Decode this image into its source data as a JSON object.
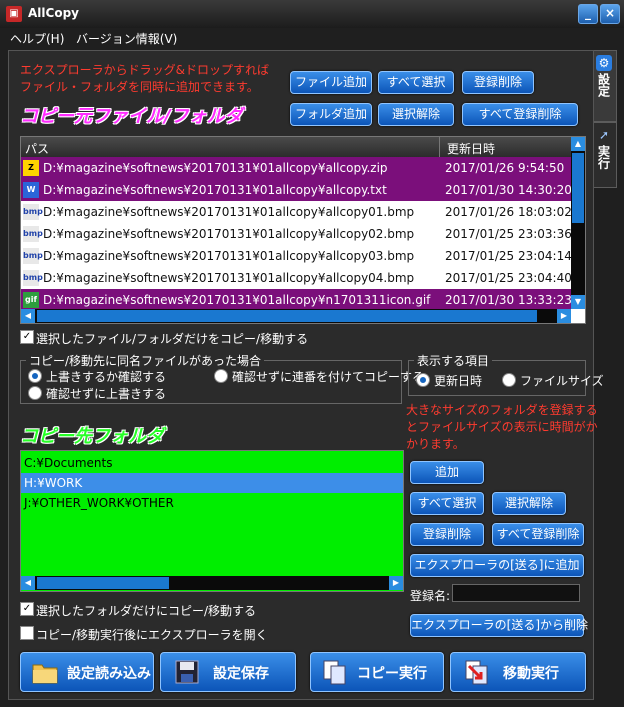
{
  "window": {
    "title": "AllCopy",
    "minimize": "_",
    "close": "×"
  },
  "menu": [
    "ヘルプ(H)",
    "バージョン情報(V)"
  ],
  "side_tabs": {
    "settings": "設定",
    "run": "実行"
  },
  "source": {
    "note_line1": "エクスプローラからドラッグ&ドロップすれば",
    "note_line2": "ファイル・フォルダを同時に追加できます。",
    "heading": "コピー元ファイル/フォルダ",
    "buttons": {
      "add_file": "ファイル追加",
      "select_all": "すべて選択",
      "remove": "登録削除",
      "add_folder": "フォルダ追加",
      "deselect": "選択解除",
      "remove_all": "すべて登録削除"
    },
    "columns": {
      "path": "パス",
      "modified": "更新日時"
    },
    "files": [
      {
        "path": "D:¥magazine¥softnews¥20170131¥01allcopy¥allcopy.zip",
        "date": "2017/01/26 9:54:50",
        "icon": "zip-icon",
        "selected": true
      },
      {
        "path": "D:¥magazine¥softnews¥20170131¥01allcopy¥allcopy.txt",
        "date": "2017/01/30 14:30:20",
        "icon": "txt-icon",
        "selected": true
      },
      {
        "path": "D:¥magazine¥softnews¥20170131¥01allcopy¥allcopy01.bmp",
        "date": "2017/01/26 18:03:02",
        "icon": "bmp-icon",
        "selected": false
      },
      {
        "path": "D:¥magazine¥softnews¥20170131¥01allcopy¥allcopy02.bmp",
        "date": "2017/01/25 23:03:36",
        "icon": "bmp-icon",
        "selected": false
      },
      {
        "path": "D:¥magazine¥softnews¥20170131¥01allcopy¥allcopy03.bmp",
        "date": "2017/01/25 23:04:14",
        "icon": "bmp-icon",
        "selected": false
      },
      {
        "path": "D:¥magazine¥softnews¥20170131¥01allcopy¥allcopy04.bmp",
        "date": "2017/01/25 23:04:40",
        "icon": "bmp-icon",
        "selected": false
      },
      {
        "path": "D:¥magazine¥softnews¥20170131¥01allcopy¥n1701311icon.gif",
        "date": "2017/01/30 13:33:23",
        "icon": "gif-icon",
        "selected": true
      }
    ],
    "only_selected_label": "選択したファイル/フォルダだけをコピー/移動する",
    "only_selected_checked": true
  },
  "conflict": {
    "legend": "コピー/移動先に同名ファイルがあった場合",
    "options": [
      "上書きするか確認する",
      "確認せずに連番を付けてコピーする",
      "確認せずに上書きする"
    ],
    "selected_index": 0
  },
  "display": {
    "legend": "表示する項目",
    "options": [
      "更新日時",
      "ファイルサイズ"
    ],
    "selected_index": 0,
    "note_line1": "大きなサイズのフォルダを登録する",
    "note_line2": "とファイルサイズの表示に時間がか",
    "note_line3": "かります。"
  },
  "dest": {
    "heading": "コピー先フォルダ",
    "folders": [
      {
        "path": "C:¥Documents",
        "selected": false
      },
      {
        "path": "H:¥WORK",
        "selected": true
      },
      {
        "path": "J:¥OTHER_WORK¥OTHER",
        "selected": false
      }
    ],
    "buttons": {
      "add": "追加",
      "select_all": "すべて選択",
      "deselect": "選択解除",
      "remove": "登録削除",
      "remove_all": "すべて登録削除",
      "add_sendto": "エクスプローラの[送る]に追加",
      "remove_sendto": "エクスプローラの[送る]から削除"
    },
    "reg_name_label": "登録名:",
    "reg_name_value": "",
    "only_selected_label": "選択したフォルダだけにコピー/移動する",
    "only_selected_checked": true,
    "open_explorer_label": "コピー/移動実行後にエクスプローラを開く",
    "open_explorer_checked": false
  },
  "actions": {
    "load": "設定読み込み",
    "save": "設定保存",
    "copy": "コピー実行",
    "move": "移動実行"
  },
  "colors": {
    "accent": "#1a6fd6",
    "selected_row": "#7b0f7b",
    "dest_bg": "#00ee00",
    "heading_magenta": "#ff2bff",
    "heading_green": "#26ff26",
    "note_red": "#ff3b2f"
  }
}
